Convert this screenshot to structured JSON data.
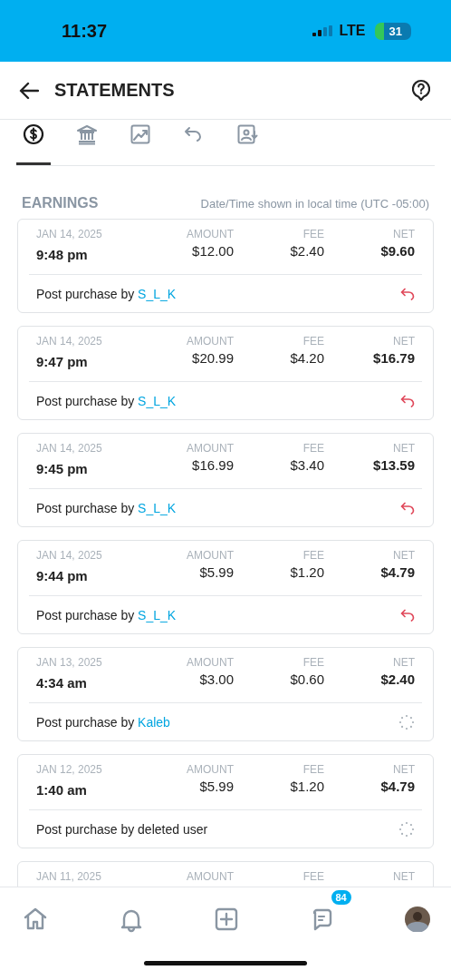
{
  "status_bar": {
    "time": "11:37",
    "network": "LTE",
    "battery": "31"
  },
  "header": {
    "title": "STATEMENTS"
  },
  "tabs": [
    {
      "kind": "earnings",
      "selected": true
    },
    {
      "kind": "bank",
      "selected": false
    },
    {
      "kind": "chart",
      "selected": false
    },
    {
      "kind": "refund",
      "selected": false
    },
    {
      "kind": "report",
      "selected": false
    }
  ],
  "section": {
    "title": "EARNINGS",
    "note": "Date/Time shown in local time (UTC -05:00)"
  },
  "transactions": [
    {
      "date": "JAN 14, 2025",
      "time": "9:48 pm",
      "columns": [
        {
          "label": "AMOUNT",
          "value": "$12.00"
        },
        {
          "label": "FEE",
          "value": "$2.40"
        },
        {
          "label": "NET",
          "value": "$9.60"
        }
      ],
      "description": "Post purchase by",
      "buyer": "S_L_K",
      "buyer_linked": true,
      "refunded": true
    },
    {
      "date": "JAN 14, 2025",
      "time": "9:47 pm",
      "columns": [
        {
          "label": "AMOUNT",
          "value": "$20.99"
        },
        {
          "label": "FEE",
          "value": "$4.20"
        },
        {
          "label": "NET",
          "value": "$16.79"
        }
      ],
      "description": "Post purchase by",
      "buyer": "S_L_K",
      "buyer_linked": true,
      "refunded": true
    },
    {
      "date": "JAN 14, 2025",
      "time": "9:45 pm",
      "columns": [
        {
          "label": "AMOUNT",
          "value": "$16.99"
        },
        {
          "label": "FEE",
          "value": "$3.40"
        },
        {
          "label": "NET",
          "value": "$13.59"
        }
      ],
      "description": "Post purchase by",
      "buyer": "S_L_K",
      "buyer_linked": true,
      "refunded": true
    },
    {
      "date": "JAN 14, 2025",
      "time": "9:44 pm",
      "columns": [
        {
          "label": "AMOUNT",
          "value": "$5.99"
        },
        {
          "label": "FEE",
          "value": "$1.20"
        },
        {
          "label": "NET",
          "value": "$4.79"
        }
      ],
      "description": "Post purchase by",
      "buyer": "S_L_K",
      "buyer_linked": true,
      "refunded": true
    },
    {
      "date": "JAN 13, 2025",
      "time": "4:34 am",
      "columns": [
        {
          "label": "AMOUNT",
          "value": "$3.00"
        },
        {
          "label": "FEE",
          "value": "$0.60"
        },
        {
          "label": "NET",
          "value": "$2.40"
        }
      ],
      "description": "Post purchase by",
      "buyer": "Kaleb",
      "buyer_linked": true,
      "refunded": false
    },
    {
      "date": "JAN 12, 2025",
      "time": "1:40 am",
      "columns": [
        {
          "label": "AMOUNT",
          "value": "$5.99"
        },
        {
          "label": "FEE",
          "value": "$1.20"
        },
        {
          "label": "NET",
          "value": "$4.79"
        }
      ],
      "description": "Post purchase by",
      "buyer": "deleted user",
      "buyer_linked": false,
      "refunded": false
    },
    {
      "date": "JAN 11, 2025",
      "columns": [
        {
          "label": "AMOUNT"
        },
        {
          "label": "FEE"
        },
        {
          "label": "NET"
        }
      ]
    }
  ],
  "bottom_nav": [
    {
      "kind": "home"
    },
    {
      "kind": "notifications"
    },
    {
      "kind": "add"
    },
    {
      "kind": "messages",
      "badge": "84"
    },
    {
      "kind": "profile"
    }
  ]
}
